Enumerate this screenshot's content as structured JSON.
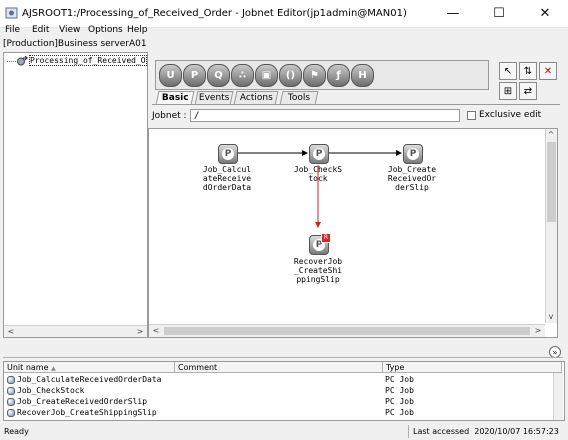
{
  "window": {
    "title": "AJSROOT1:/Processing_of_Received_Order - Jobnet Editor(jp1admin@MAN01)",
    "minimize": "—",
    "maximize": "☐",
    "close": "✕"
  },
  "menu": [
    "File",
    "Edit",
    "View",
    "Options",
    "Help"
  ],
  "server_label": "[Production]Business serverA01",
  "tree": {
    "item": "Processing_of_Received_Order"
  },
  "palette": {
    "icons": [
      "U",
      "P",
      "Q",
      "∴",
      "▣",
      "()",
      "⚑",
      "ƒ",
      "H"
    ]
  },
  "tabs": [
    "Basic",
    "Events",
    "Actions",
    "Tools"
  ],
  "jobnet": {
    "label": "Jobnet :",
    "path": "/"
  },
  "exclusive_edit": "Exclusive edit",
  "nodes": [
    {
      "label": "Job_Calcul\nateReceive\ndOrderData"
    },
    {
      "label": "Job_CheckS\ntock"
    },
    {
      "label": "Job_Create\nReceivedOr\nderSlip"
    },
    {
      "label": "RecoverJob\n_CreateShi\nppingSlip"
    }
  ],
  "list": {
    "columns": [
      "Unit name",
      "Comment",
      "Type"
    ],
    "sort_indicator": "▲",
    "rows": [
      {
        "name": "Job_CalculateReceivedOrderData",
        "type": "PC Job"
      },
      {
        "name": "Job_CheckStock",
        "type": "PC Job"
      },
      {
        "name": "Job_CreateReceivedOrderSlip",
        "type": "PC Job"
      },
      {
        "name": "RecoverJob_CreateShippingSlip",
        "type": "PC Job"
      }
    ]
  },
  "status": {
    "left": "Ready",
    "right": "Last accessed  2020/10/07 16:57:23"
  },
  "colors": {
    "arrow": "#000000",
    "recovery_arrow": "#d02020"
  }
}
